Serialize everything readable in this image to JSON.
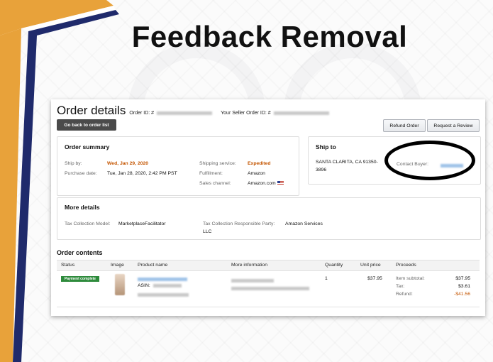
{
  "slide": {
    "title": "Feedback Removal"
  },
  "order": {
    "title": "Order details",
    "order_id_label": "Order ID: #",
    "seller_order_id_label": "Your Seller Order ID: #",
    "back_button": "Go back to order list",
    "refund_button": "Refund Order",
    "review_button": "Request a Review"
  },
  "summary": {
    "title": "Order summary",
    "ship_by_label": "Ship by:",
    "ship_by_value": "Wed, Jan 29, 2020",
    "purchase_date_label": "Purchase date:",
    "purchase_date_value": "Tue, Jan 28, 2020, 2:42 PM PST",
    "shipping_service_label": "Shipping service:",
    "shipping_service_value": "Expedited",
    "fulfillment_label": "Fulfillment:",
    "fulfillment_value": "Amazon",
    "sales_channel_label": "Sales channel:",
    "sales_channel_value": "Amazon.com"
  },
  "ship_to": {
    "title": "Ship to",
    "address_line1": "SANTA CLARITA, CA 91350-",
    "address_line2": "3896",
    "contact_label": "Contact Buyer:"
  },
  "more_details": {
    "title": "More details",
    "tax_model_label": "Tax Collection Model:",
    "tax_model_value": "MarketplaceFacilitator",
    "tax_party_label": "Tax Collection Responsible Party:",
    "tax_party_value_1": "Amazon Services",
    "tax_party_value_2": "LLC"
  },
  "contents": {
    "title": "Order contents",
    "headers": [
      "Status",
      "Image",
      "Product name",
      "More information",
      "Quantity",
      "Unit price",
      "Proceeds"
    ],
    "row": {
      "status": "Payment complete",
      "asin_label": "ASIN:",
      "quantity": "1",
      "unit_price": "$37.95",
      "item_subtotal_label": "Item subtotal:",
      "item_subtotal": "$37.95",
      "tax_label": "Tax:",
      "tax": "$3.61",
      "refund_label": "Refund:",
      "refund": "-$41.56"
    }
  },
  "colors": {
    "accent_orange": "#c45500",
    "badge_green": "#2e8b3c",
    "deco_navy": "#1f2a6b",
    "deco_gold": "#e8a23a"
  }
}
